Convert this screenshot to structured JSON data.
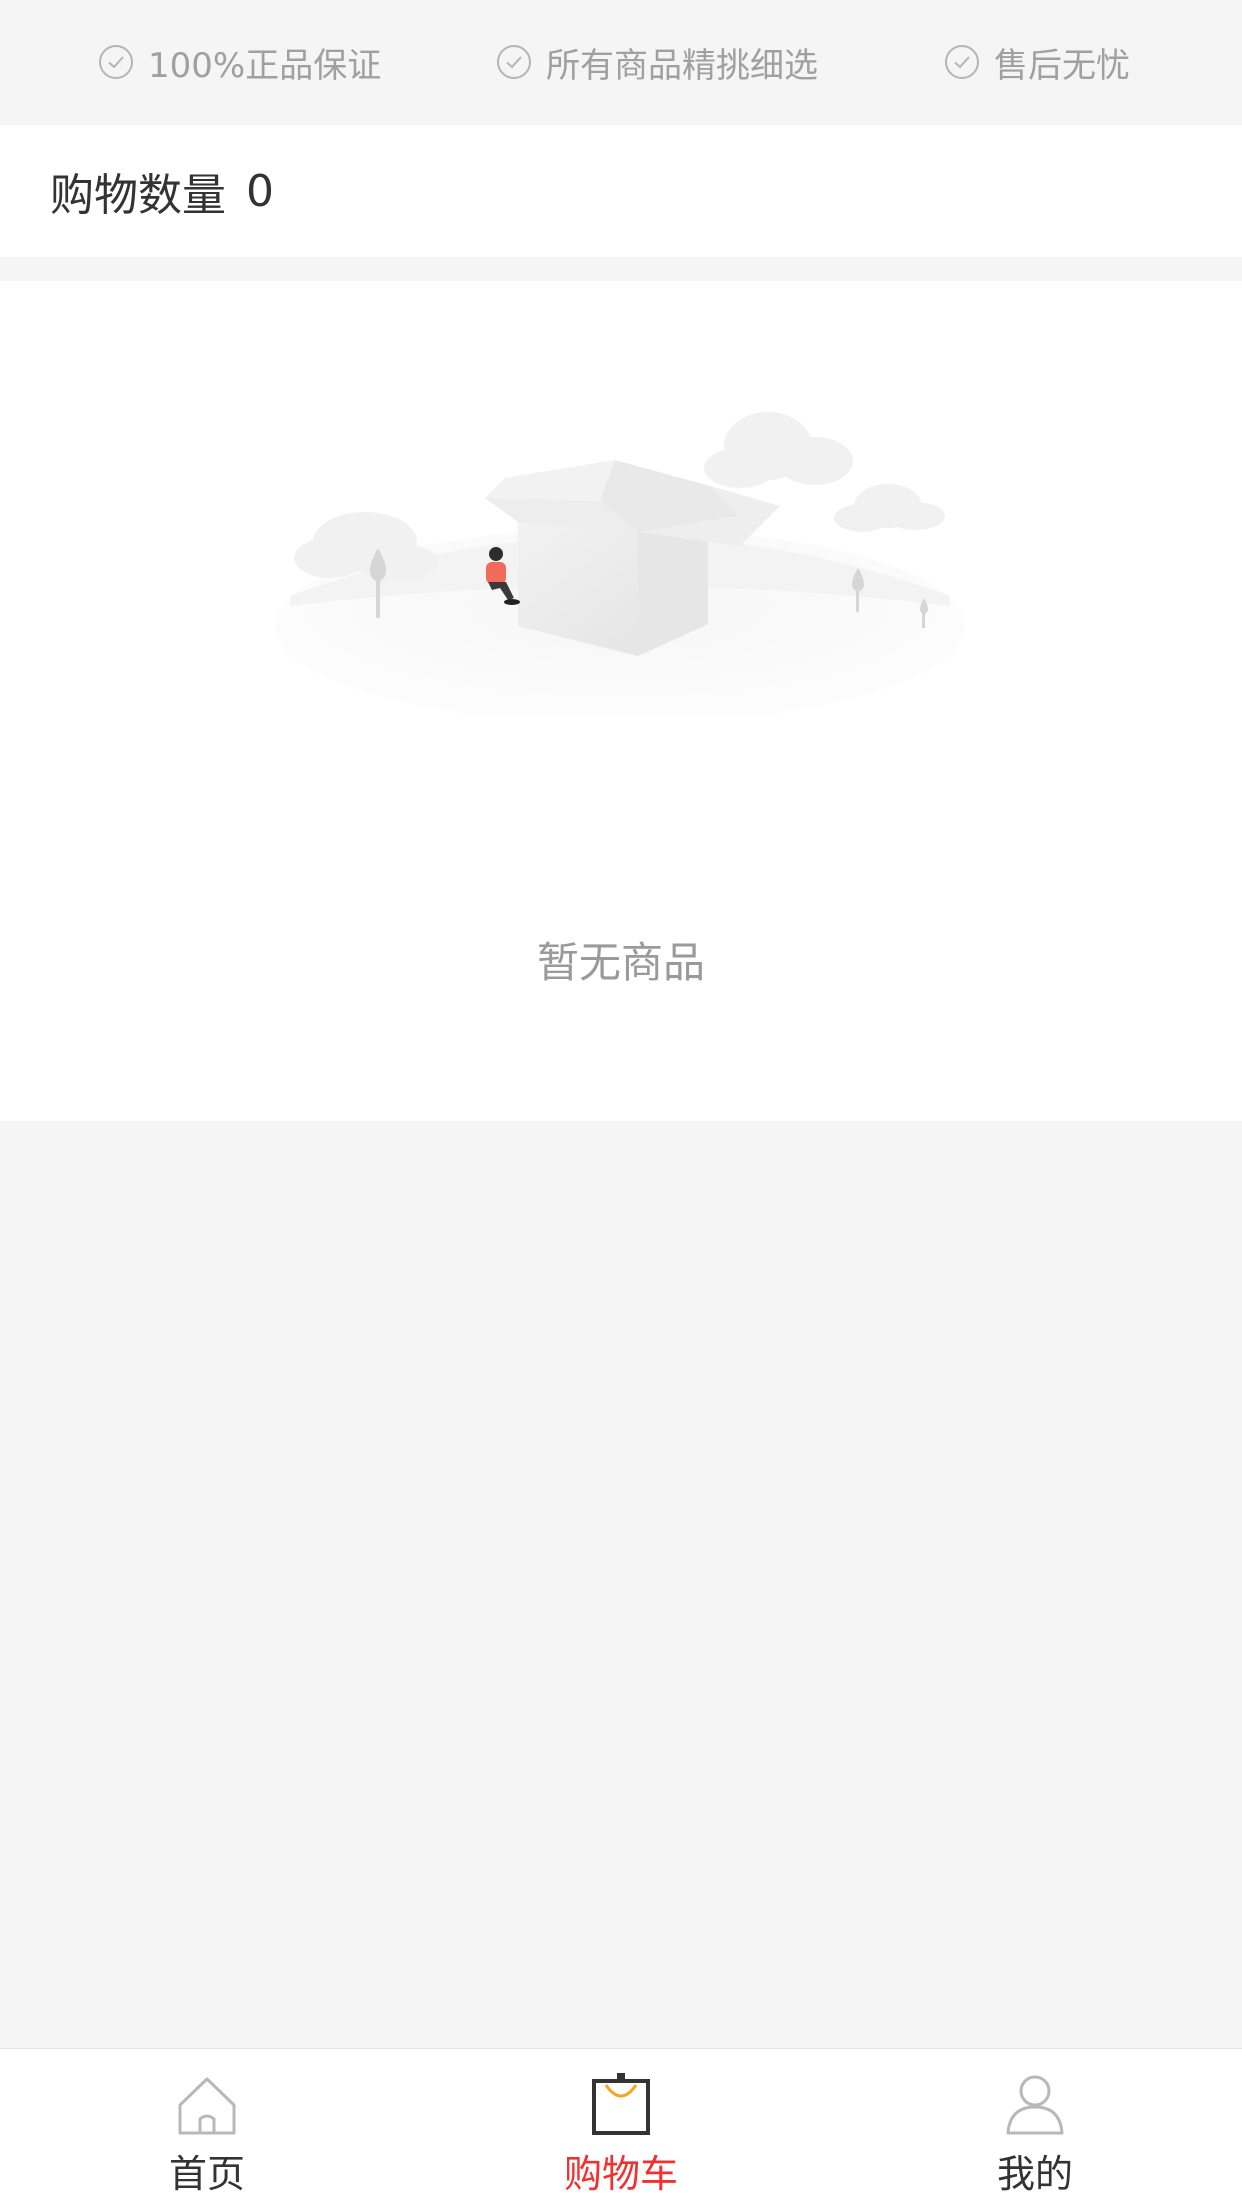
{
  "guarantees": [
    {
      "icon": "check-circle-icon",
      "label": "100%正品保证"
    },
    {
      "icon": "check-circle-icon",
      "label": "所有商品精挑细选"
    },
    {
      "icon": "check-circle-icon",
      "label": "售后无忧"
    }
  ],
  "cart": {
    "count_label": "购物数量",
    "count_value": "0"
  },
  "empty_state": {
    "illustration": "empty-box-illustration",
    "message": "暂无商品"
  },
  "tabs": [
    {
      "icon": "home-icon",
      "label": "首页",
      "active": false
    },
    {
      "icon": "shopping-bag-icon",
      "label": "购物车",
      "active": true
    },
    {
      "icon": "user-icon",
      "label": "我的",
      "active": false
    }
  ],
  "colors": {
    "accent": "#f23030",
    "bag_handle": "#f5a623",
    "background": "#f5f5f5"
  }
}
